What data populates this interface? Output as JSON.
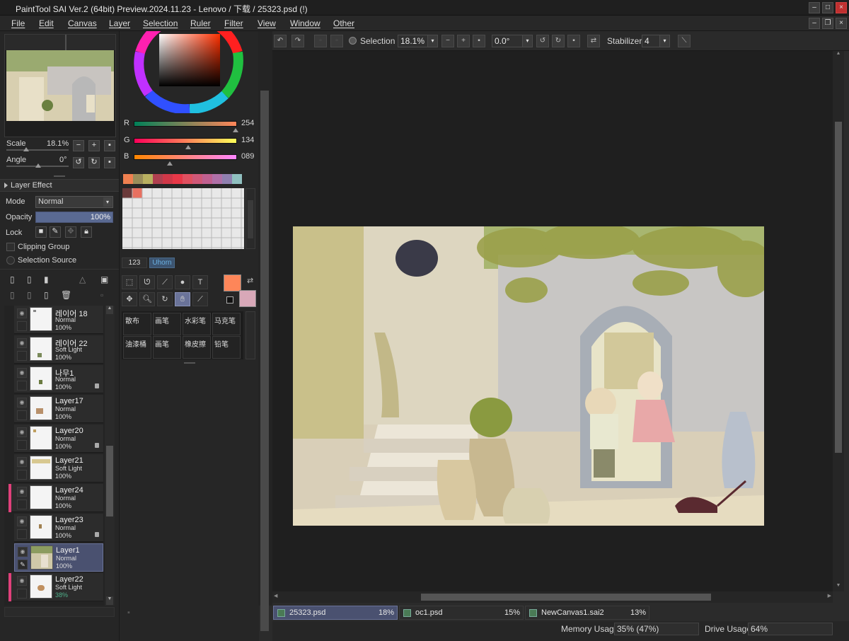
{
  "window": {
    "title": "PaintTool SAI Ver.2 (64bit) Preview.2024.11.23 - Lenovo / 下载 / 25323.psd (!)"
  },
  "menu": [
    "File",
    "Edit",
    "Canvas",
    "Layer",
    "Selection",
    "Ruler",
    "Filter",
    "View",
    "Window",
    "Other"
  ],
  "navigator": {
    "scale_label": "Scale",
    "scale_value": "18.1%",
    "angle_label": "Angle",
    "angle_value": "0°"
  },
  "layer_effect": {
    "label": "Layer Effect",
    "mode_label": "Mode",
    "mode_value": "Normal",
    "opacity_label": "Opacity",
    "opacity_value": "100%",
    "lock_label": "Lock",
    "clipping_group": "Clipping Group",
    "selection_source": "Selection Source"
  },
  "layers": [
    {
      "name": "레이어 18",
      "mode": "Normal",
      "opacity": "100%"
    },
    {
      "name": "레이어 22",
      "mode": "Soft Light",
      "opacity": "100%"
    },
    {
      "name": "나무1",
      "mode": "Normal",
      "opacity": "100%"
    },
    {
      "name": "Layer17",
      "mode": "Normal",
      "opacity": "100%"
    },
    {
      "name": "Layer20",
      "mode": "Normal",
      "opacity": "100%"
    },
    {
      "name": "Layer21",
      "mode": "Soft Light",
      "opacity": "100%"
    },
    {
      "name": "Layer24",
      "mode": "Normal",
      "opacity": "100%"
    },
    {
      "name": "Layer23",
      "mode": "Normal",
      "opacity": "100%"
    },
    {
      "name": "Layer1",
      "mode": "Normal",
      "opacity": "100%"
    },
    {
      "name": "Layer22",
      "mode": "Soft Light",
      "opacity": "38%"
    }
  ],
  "color": {
    "r_label": "R",
    "r_value": "254",
    "g_label": "G",
    "g_value": "134",
    "b_label": "B",
    "b_value": "089",
    "primary": "#fe8659",
    "secondary": "#d8a8b8"
  },
  "swatches": [
    "#f08050",
    "#9a8e5a",
    "#b8b060",
    "#b04050",
    "#d03848",
    "#e83848",
    "#e05060",
    "#d05878",
    "#c06090",
    "#b070a8",
    "#9080b0",
    "#90c0c0"
  ],
  "palette_tabs": {
    "num": "123",
    "uhorn": "Uhorn"
  },
  "brushes": [
    "散布",
    "画笔",
    "水彩笔",
    "马克笔",
    "油漆桶",
    "画笔",
    "橡皮擦",
    "铅笔"
  ],
  "toolbar": {
    "selection_label": "Selection",
    "zoom_value": "18.1%",
    "angle_value": "0.0°",
    "stabilizer_label": "Stabilizer",
    "stabilizer_value": "4"
  },
  "tabs": [
    {
      "name": "25323.psd",
      "pct": "18%"
    },
    {
      "name": "oc1.psd",
      "pct": "15%"
    },
    {
      "name": "NewCanvas1.sai2",
      "pct": "13%"
    }
  ],
  "status": {
    "memory_label": "Memory Usage",
    "memory_value": "35% (47%)",
    "drive_label": "Drive Usage",
    "drive_value": "64%"
  }
}
